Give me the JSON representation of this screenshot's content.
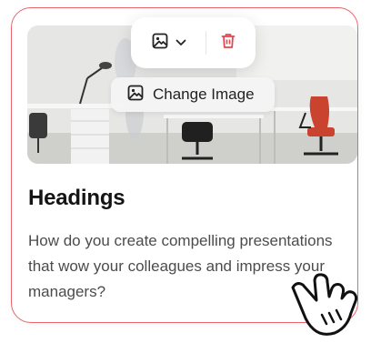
{
  "card": {
    "heading": "Headings",
    "description": "How do you create compelling presentations that wow your colleagues and impress your managers?"
  },
  "toolbar": {
    "image_menu_icon": "image-icon",
    "dropdown_icon": "chevron-down-icon",
    "delete_icon": "trash-icon"
  },
  "change_image": {
    "label": "Change Image",
    "icon": "image-icon"
  },
  "colors": {
    "card_border": "#e8646f",
    "delete_red": "#e2474f",
    "text_dark": "#141414",
    "text_body": "#4c4c4c"
  }
}
